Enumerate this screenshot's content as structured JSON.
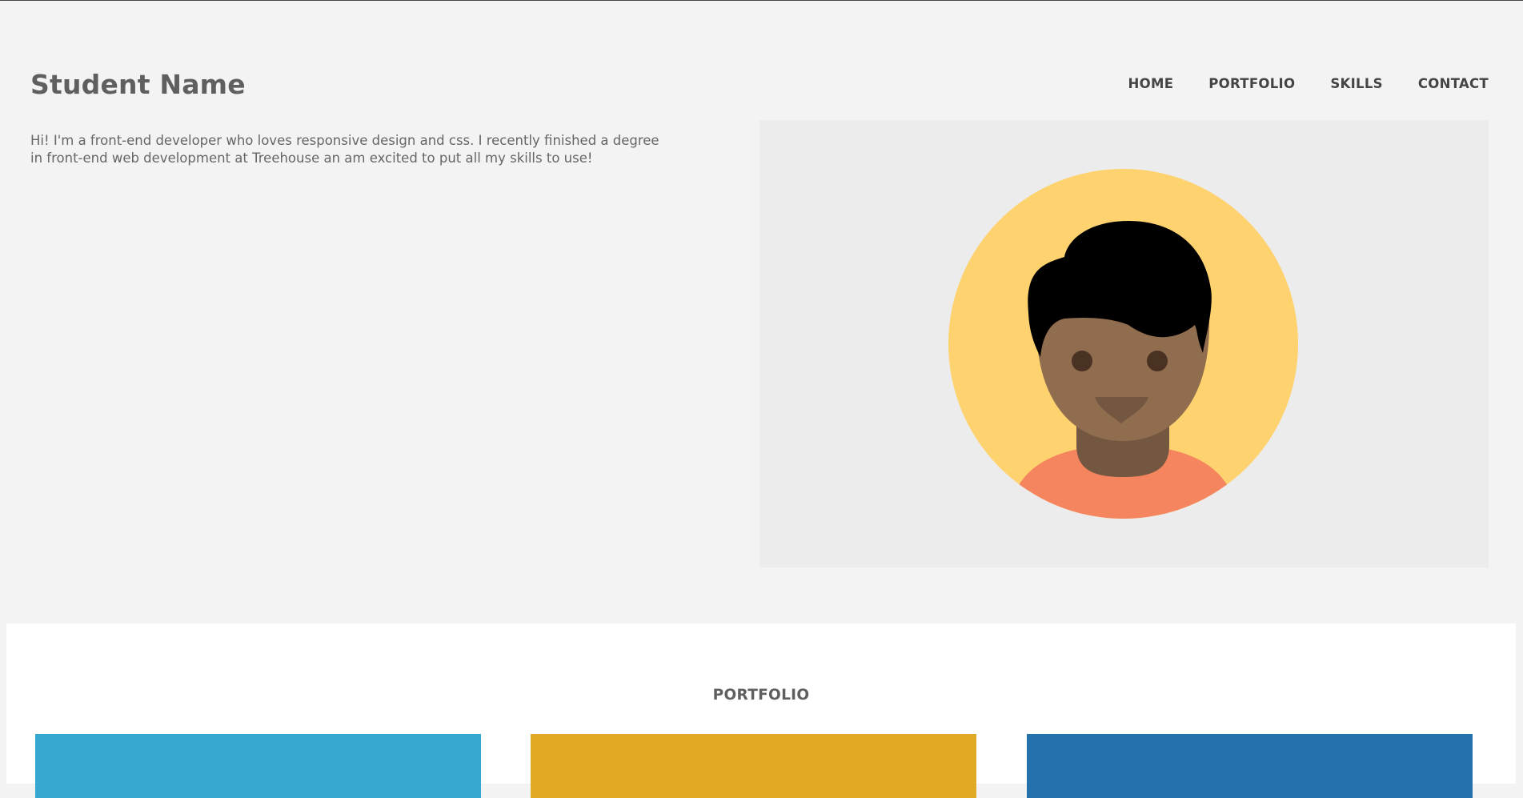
{
  "header": {
    "site_name": "Student Name"
  },
  "nav": {
    "items": [
      "HOME",
      "PORTFOLIO",
      "SKILLS",
      "CONTACT"
    ]
  },
  "intro": {
    "text": "Hi! I'm a front-end developer who loves responsive design and css. I recently finished a degree in front-end web development at Treehouse an am excited to put all my skills to use!"
  },
  "avatar": {
    "icon": "person-avatar-illustration",
    "colors": {
      "circle": "#fed26e",
      "hair": "#000000",
      "face": "#8f6d4e",
      "neck": "#735741",
      "eyes": "#4a3222",
      "shirt": "#f5855f"
    }
  },
  "portfolio": {
    "title": "PORTFOLIO",
    "cards": [
      {
        "color": "#36a9d0"
      },
      {
        "color": "#e0a926"
      },
      {
        "color": "#2471ab"
      }
    ]
  }
}
